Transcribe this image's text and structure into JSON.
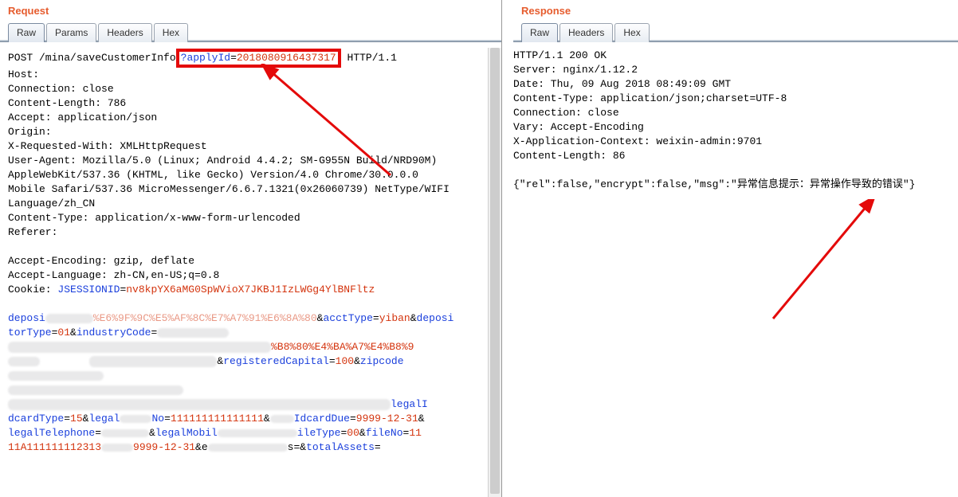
{
  "request": {
    "title": "Request",
    "tabs": [
      "Raw",
      "Params",
      "Headers",
      "Hex"
    ],
    "activeTab": "Raw",
    "line1_pre": "POST /mina/saveCustomerInfo",
    "highlight_q": "?",
    "highlight_param": "applyId",
    "highlight_eq": "=",
    "highlight_value": "201808091643731",
    "highlight_trail": "7",
    "line1_post": " HTTP/1.1",
    "lines_block1": "Host: \nConnection: close\nContent-Length: 786\nAccept: application/json\nOrigin: \nX-Requested-With: XMLHttpRequest\nUser-Agent: Mozilla/5.0 (Linux; Android 4.4.2; SM-G955N Build/NRD90M)\nAppleWebKit/537.36 (KHTML, like Gecko) Version/4.0 Chrome/30.0.0.0\nMobile Safari/537.36 MicroMessenger/6.6.7.1321(0x26060739) NetType/WIFI\nLanguage/zh_CN\nContent-Type: application/x-www-form-urlencoded\nReferer:\n",
    "lines_block2": "\nAccept-Encoding: gzip, deflate\nAccept-Language: zh-CN,en-US;q=0.8\nCookie: ",
    "cookie_key": "JSESSIONID",
    "cookie_eq": "=",
    "cookie_val": "nv8kpYX6aMG0SpWVioX7JKBJ1IzLWGg4YlBNFltz",
    "body_frag1_a": "deposi",
    "body_frag1_b": "torType",
    "body_frag1_c": "=",
    "body_frag1_d": "01",
    "body_frag1_e": "&",
    "body_frag1_f": "industryCode",
    "body_frag1_g": "=",
    "body_frag2_a": "&",
    "body_frag2_b": "acctType",
    "body_frag2_c": "=",
    "body_frag2_d": "yiban",
    "body_frag2_e": "&",
    "body_frag2_f": "deposi",
    "body_frag3_txt": "%B8%80%E4%BA%A7%E4%B8%9",
    "body_frag4_a": "&",
    "body_frag4_b": "registeredCapital",
    "body_frag4_c": "=",
    "body_frag4_d": "100",
    "body_frag4_e": "&",
    "body_frag4_f": "zipcode",
    "body_frag5_txt": "legalI",
    "body_frag6_a": "dcardType",
    "body_frag6_b": "=",
    "body_frag6_c": "15",
    "body_frag6_d": "&",
    "body_frag6_e": "legal",
    "body_frag6_f": "No",
    "body_frag6_g": "=",
    "body_frag6_h": "111111111111111",
    "body_frag6_i": "&",
    "body_frag6_j": "IdcardDue",
    "body_frag6_k": "=",
    "body_frag6_l": "9999-12-31",
    "body_frag6_m": "&",
    "body_frag7_a": "legalTelephone",
    "body_frag7_b": "=",
    "body_frag7_c": "&",
    "body_frag7_d": "legalMobil",
    "body_frag7_e": "ileType",
    "body_frag7_f": "=",
    "body_frag7_g": "00",
    "body_frag7_h": "&",
    "body_frag7_i": "fileNo",
    "body_frag7_j": "=",
    "body_frag7_k": "11",
    "body_frag8_a": "11A111111112313",
    "body_frag8_b": "9999-12-31",
    "body_frag8_c": "&e",
    "body_frag8_d": "s=",
    "body_frag8_e": "&",
    "body_frag8_f": "totalAssets",
    "body_frag8_g": "="
  },
  "response": {
    "title": "Response",
    "tabs": [
      "Raw",
      "Headers",
      "Hex"
    ],
    "activeTab": "Raw",
    "headers": "HTTP/1.1 200 OK\nServer: nginx/1.12.2\nDate: Thu, 09 Aug 2018 08:49:09 GMT\nContent-Type: application/json;charset=UTF-8\nConnection: close\nVary: Accept-Encoding\nX-Application-Context: weixin-admin:9701\nContent-Length: 86\n",
    "body": "{\"rel\":false,\"encrypt\":false,\"msg\":\"异常信息提示：异常操作导致的错误\"}"
  }
}
